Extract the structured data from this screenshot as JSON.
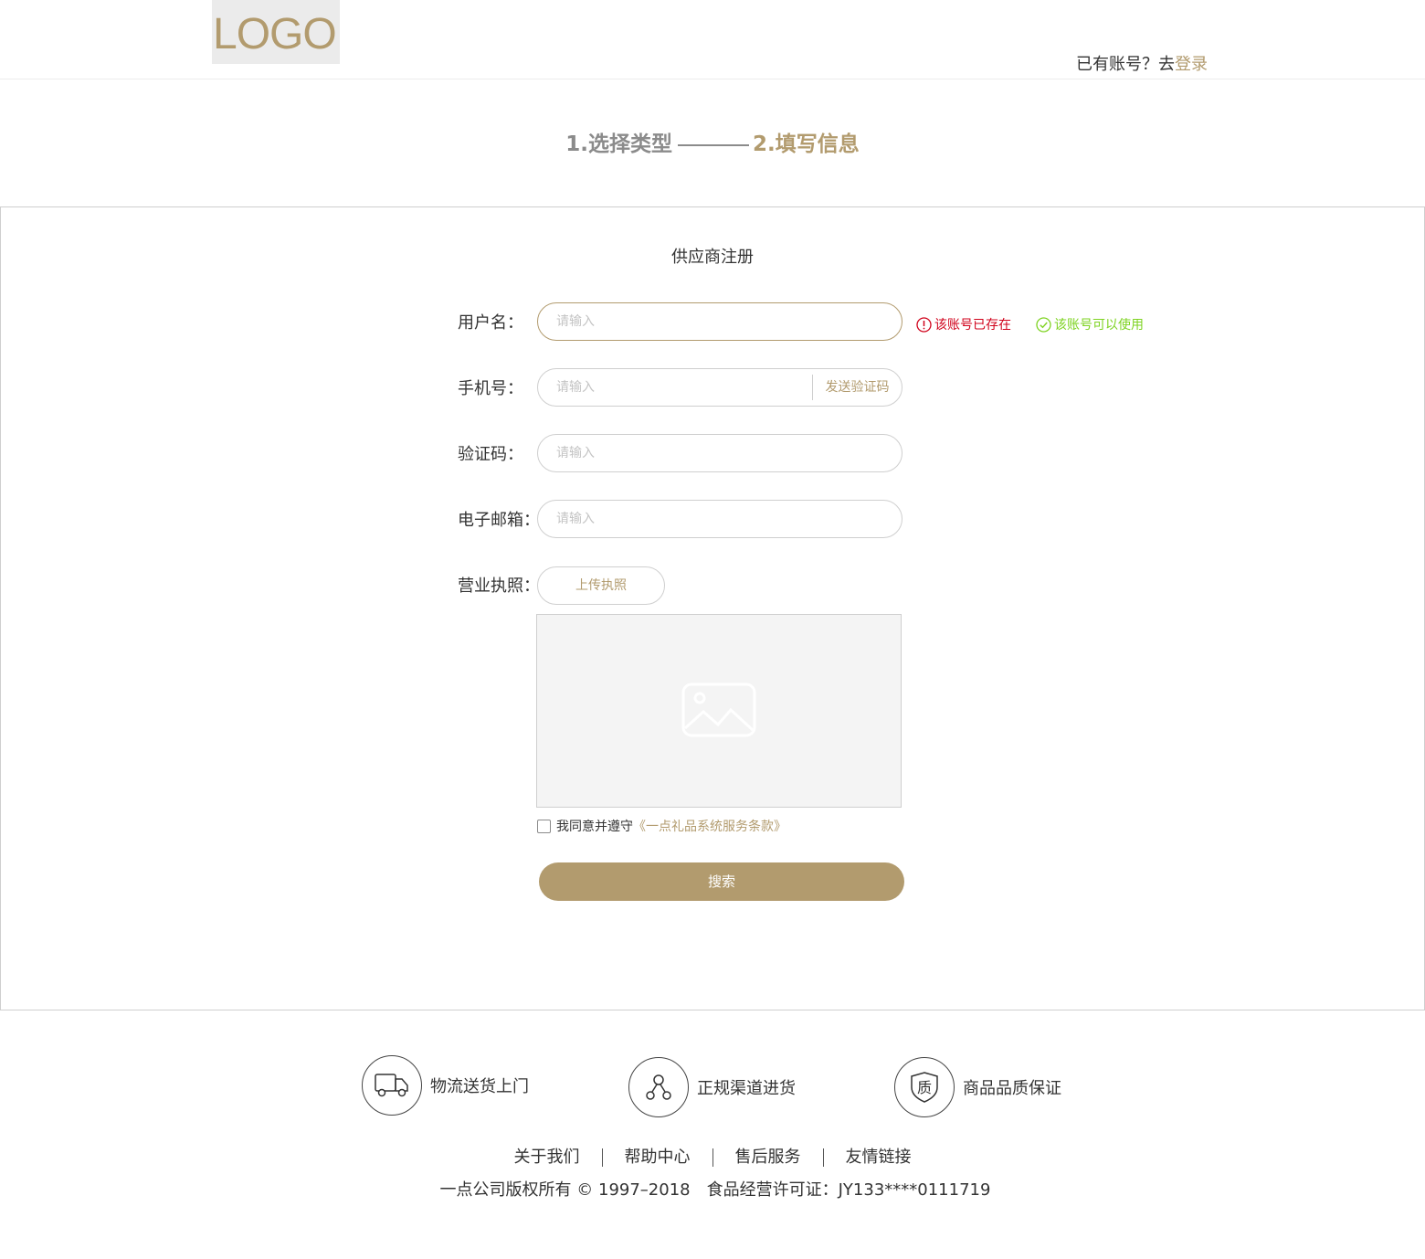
{
  "header": {
    "logo": "LOGO",
    "login_prompt": "已有账号？去",
    "login_link": "登录"
  },
  "steps": {
    "step1": "1.选择类型",
    "step2": "2.填写信息"
  },
  "form": {
    "title": "供应商注册",
    "username_label": "用户名：",
    "username_placeholder": "请输入",
    "phone_label": "手机号：",
    "phone_placeholder": "请输入",
    "send_code": "发送验证码",
    "code_label": "验证码：",
    "code_placeholder": "请输入",
    "email_label": "电子邮箱：",
    "email_placeholder": "请输入",
    "license_label": "营业执照：",
    "upload_button": "上传执照",
    "msg_exists": "该账号已存在",
    "msg_ok": "该账号可以使用",
    "agree_text": "我同意并遵守",
    "terms_link": "《一点礼品系统服务条款》",
    "submit": "搜索"
  },
  "colors": {
    "accent": "#b29b6e",
    "error": "#d0021b",
    "success": "#7ed321"
  },
  "footer": {
    "features": [
      {
        "icon": "truck-icon",
        "label": "物流送货上门"
      },
      {
        "icon": "channel-icon",
        "label": "正规渠道进货"
      },
      {
        "icon": "quality-shield-icon",
        "label": "商品品质保证"
      }
    ],
    "links": [
      "关于我们",
      "帮助中心",
      "售后服务",
      "友情链接"
    ],
    "copyright": "一点公司版权所有 © 1997–2018　食品经营许可证：JY133****0111719"
  }
}
